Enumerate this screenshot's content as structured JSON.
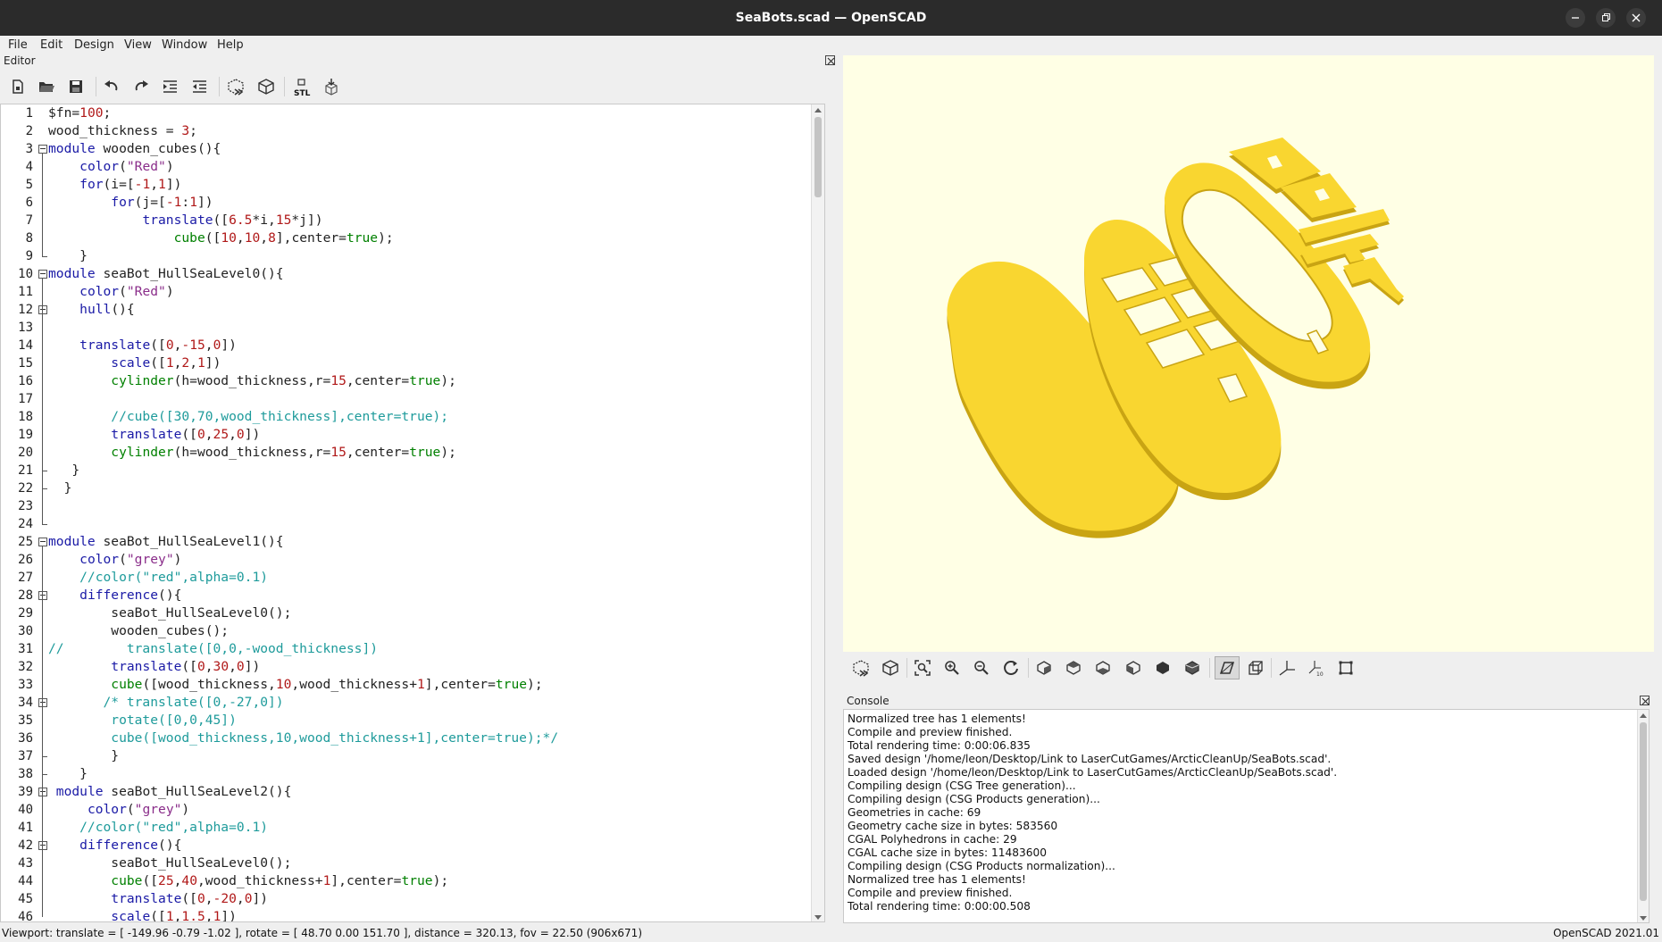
{
  "window": {
    "title": "SeaBots.scad — OpenSCAD"
  },
  "menu": [
    "File",
    "Edit",
    "Design",
    "View",
    "Window",
    "Help"
  ],
  "editor": {
    "dock_title": "Editor",
    "toolbar_icons": [
      "new-file-icon",
      "open-file-icon",
      "save-icon",
      "undo-icon",
      "redo-icon",
      "indent-icon",
      "unindent-icon",
      "preview-icon",
      "render-icon",
      "export-stl-icon",
      "send-to-print-icon"
    ],
    "toolbar_stl_label": "STL",
    "line_numbers": [
      "1",
      "2",
      "3",
      "4",
      "5",
      "6",
      "7",
      "8",
      "9",
      "10",
      "11",
      "12",
      "13",
      "14",
      "15",
      "16",
      "17",
      "18",
      "19",
      "20",
      "21",
      "22",
      "23",
      "24",
      "25",
      "26",
      "27",
      "28",
      "29",
      "30",
      "31",
      "32",
      "33",
      "34",
      "35",
      "36",
      "37",
      "38",
      "39",
      "40",
      "41",
      "42",
      "43",
      "44",
      "45",
      "46"
    ],
    "lines": [
      "$fn=100;",
      "wood_thickness = 3;",
      "module wooden_cubes(){",
      "    color(\"Red\")",
      "    for(i=[-1,1])",
      "        for(j=[-1:1])",
      "            translate([6.5*i,15*j])",
      "                cube([10,10,8],center=true);",
      "    }",
      "module seaBot_HullSeaLevel0(){",
      "    color(\"Red\")",
      "    hull(){",
      "",
      "    translate([0,-15,0])",
      "        scale([1,2,1])",
      "        cylinder(h=wood_thickness,r=15,center=true);",
      "",
      "        //cube([30,70,wood_thickness],center=true);",
      "        translate([0,25,0])",
      "        cylinder(h=wood_thickness,r=15,center=true);",
      "   }",
      "  }",
      "",
      "",
      "module seaBot_HullSeaLevel1(){",
      "    color(\"grey\")",
      "    //color(\"red\",alpha=0.1)",
      "    difference(){",
      "        seaBot_HullSeaLevel0();",
      "        wooden_cubes();",
      "//        translate([0,0,-wood_thickness])",
      "        translate([0,30,0])",
      "        cube([wood_thickness,10,wood_thickness+1],center=true);",
      "       /* translate([0,-27,0])",
      "        rotate([0,0,45])",
      "        cube([wood_thickness,10,wood_thickness+1],center=true);*/",
      "        }",
      "    }",
      " module seaBot_HullSeaLevel2(){",
      "     color(\"grey\")",
      "    //color(\"red\",alpha=0.1)",
      "    difference(){",
      "        seaBot_HullSeaLevel0();",
      "        cube([25,40,wood_thickness+1],center=true);",
      "        translate([0,-20,0])",
      "        scale([1,1.5,1])"
    ]
  },
  "view_toolbar_icons": [
    "preview-icon",
    "render-icon",
    "view-all-icon",
    "zoom-in-icon",
    "zoom-out-icon",
    "reset-view-icon",
    "view-right-icon",
    "view-top-icon",
    "view-bottom-icon",
    "view-left-icon",
    "view-front-icon",
    "view-back-icon",
    "perspective-icon",
    "orthogonal-icon",
    "show-axes-icon",
    "show-scale-markers-icon",
    "show-edges-icon"
  ],
  "console": {
    "title": "Console",
    "lines": [
      "Normalized tree has 1 elements!",
      "Compile and preview finished.",
      "Total rendering time: 0:00:06.835",
      "Saved design '/home/leon/Desktop/Link to LaserCutGames/ArcticCleanUp/SeaBots.scad'.",
      "Loaded design '/home/leon/Desktop/Link to LaserCutGames/ArcticCleanUp/SeaBots.scad'.",
      "Compiling design (CSG Tree generation)...",
      "Compiling design (CSG Products generation)...",
      "Geometries in cache: 69",
      "Geometry cache size in bytes: 583560",
      "CGAL Polyhedrons in cache: 29",
      "CGAL cache size in bytes: 11483600",
      "Compiling design (CSG Products normalization)...",
      "Normalized tree has 1 elements!",
      "Compile and preview finished.",
      "Total rendering time: 0:00:00.508"
    ]
  },
  "status": {
    "viewport": "Viewport: translate = [ -149.96 -0.79 -1.02 ], rotate = [ 48.70 0.00 151.70 ], distance = 320.13, fov = 22.50 (906x671)",
    "version": "OpenSCAD 2021.01"
  },
  "colors": {
    "viewport_bg": "#ffffe5",
    "model_fill": "#f9d630",
    "model_shadow": "#c9a413",
    "titlebar_bg": "#2b2b2b"
  }
}
